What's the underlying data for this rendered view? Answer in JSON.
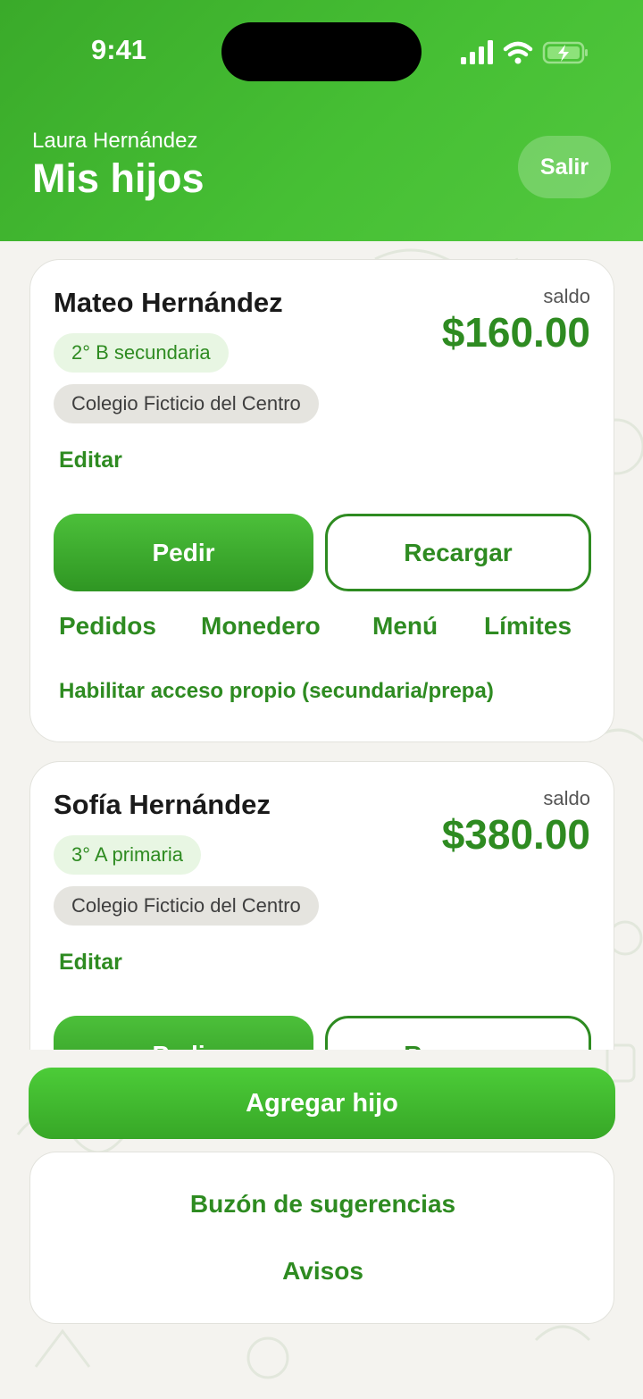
{
  "status_bar": {
    "time": "9:41"
  },
  "header": {
    "parent_name": "Laura Hernández",
    "title": "Mis hijos",
    "logout_label": "Salir"
  },
  "children": [
    {
      "name": "Mateo Hernández",
      "balance_label": "saldo",
      "balance": "$160.00",
      "grade": "2° B secundaria",
      "school": "Colegio Ficticio del Centro",
      "edit_label": "Editar",
      "order_label": "Pedir",
      "recharge_label": "Recargar",
      "links": [
        "Pedidos",
        "Monedero",
        "Menú",
        "Límites"
      ],
      "access_label": "Habilitar acceso propio (secundaria/prepa)"
    },
    {
      "name": "Sofía Hernández",
      "balance_label": "saldo",
      "balance": "$380.00",
      "grade": "3° A primaria",
      "school": "Colegio Ficticio del Centro",
      "edit_label": "Editar",
      "order_label": "Pedir",
      "recharge_label": "Recargar"
    }
  ],
  "actions": {
    "add_child_label": "Agregar hijo",
    "suggestions_label": "Buzón de sugerencias",
    "notices_label": "Avisos"
  },
  "colors": {
    "brand_green": "#46bf34",
    "text_green": "#2e8b21"
  },
  "icons": [
    "signal-icon",
    "wifi-icon",
    "battery-charging-icon"
  ]
}
